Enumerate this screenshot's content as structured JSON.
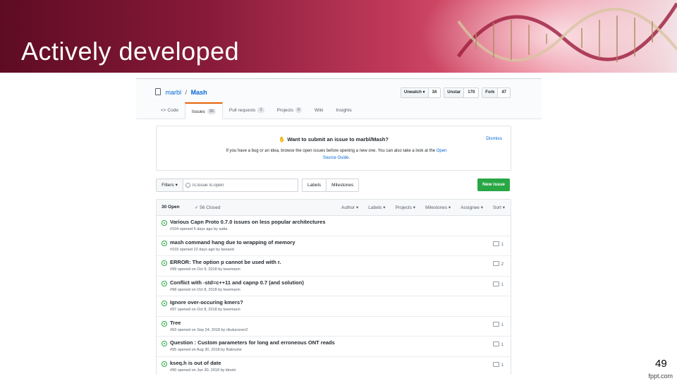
{
  "slide": {
    "title": "Actively developed",
    "page_number": "49",
    "footer": "fppt.com"
  },
  "colors": {
    "banner_dark": "#5e0b24",
    "banner_light": "#e7627a",
    "link": "#0366d6",
    "open_green": "#28a745",
    "tab_accent": "#e36209"
  },
  "repo": {
    "owner": "marbl",
    "separator": "/",
    "name": "Mash",
    "actions": [
      {
        "label": "Unwatch ▾",
        "count": "34",
        "icon": "eye-icon"
      },
      {
        "label": "Unstar",
        "count": "170",
        "icon": "star-icon"
      },
      {
        "label": "Fork",
        "count": "47",
        "icon": "fork-icon"
      }
    ],
    "tabs": [
      {
        "label": "<> Code",
        "badge": ""
      },
      {
        "label": "Issues",
        "badge": "30"
      },
      {
        "label": "Pull requests",
        "badge": "1"
      },
      {
        "label": "Projects",
        "badge": "0"
      },
      {
        "label": "Wiki",
        "badge": ""
      },
      {
        "label": "Insights",
        "badge": ""
      }
    ]
  },
  "notice": {
    "title": "Want to submit an issue to marbl/Mash?",
    "body": "If you have a bug or an idea, browse the open issues before opening a new one. You can also take a look at the",
    "link": "Open Source Guide",
    "dismiss": "Dismiss"
  },
  "filterbar": {
    "filters": "Filters ▾",
    "search_value": "is:issue is:open",
    "labels": "Labels",
    "milestones": "Milestones",
    "new_issue": "New issue"
  },
  "list_header": {
    "open": "30 Open",
    "closed": "✓ 56 Closed",
    "menus": [
      "Author ▾",
      "Labels ▾",
      "Projects ▾",
      "Milestones ▾",
      "Assignee ▾",
      "Sort ▾"
    ]
  },
  "issues": [
    {
      "title": "Various Capn Proto 0.7.0 issues on less popular architectures",
      "meta": "#104 opened 6 days ago by satta",
      "comments": ""
    },
    {
      "title": "mash command hang due to wrapping of memory",
      "meta": "#103 opened 22 days ago by beeaed",
      "comments": "1"
    },
    {
      "title": "ERROR: The option p cannot be used with r.",
      "meta": "#99 opened on Oct 9, 2018 by tseemann",
      "comments": "2"
    },
    {
      "title": "Conflict with -std=c++11 and capnp 0.7 (and solution)",
      "meta": "#98 opened on Oct 8, 2018 by tseemann",
      "comments": "1"
    },
    {
      "title": "Ignore over-occuring kmers?",
      "meta": "#97 opened on Oct 8, 2018 by tseemann",
      "comments": ""
    },
    {
      "title": "Tree",
      "meta": "#93 opened on Sep 24, 2018 by rikuturunen2",
      "comments": "1"
    },
    {
      "title": "Question : Custom parameters for long and erroneous ONT reads",
      "meta": "#95 opened on Aug 30, 2018 by Rabouhe",
      "comments": "1"
    },
    {
      "title": "kseq.h is out of date",
      "meta": "#90 opened on Jun 30, 2018 by ldostri",
      "comments": "1"
    }
  ]
}
